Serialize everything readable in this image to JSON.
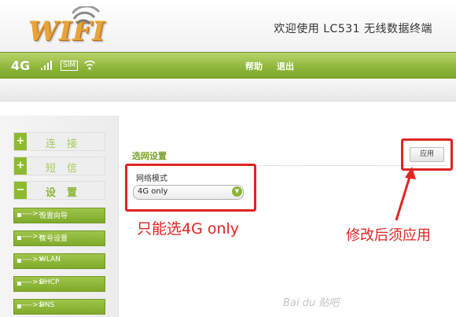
{
  "header": {
    "logo_text": "WIFI",
    "welcome": "欢迎使用 LC531 无线数据终端"
  },
  "navbar": {
    "network": "4G",
    "sim_label": "SIM",
    "help": "帮助",
    "logout": "退出",
    "icons": [
      "signal-icon",
      "sim-icon",
      "wifi-icon"
    ]
  },
  "sidebar": {
    "menus": [
      {
        "label": "连接",
        "symbol": "+"
      },
      {
        "label": "短信",
        "symbol": "+"
      },
      {
        "label": "设置",
        "symbol": "−"
      }
    ],
    "sub_arrow": "---->>",
    "sub_items": [
      "设置向导",
      "拨号设置",
      "WLAN",
      "DHCP",
      "DNS"
    ]
  },
  "main": {
    "section_title": "选网设置",
    "apply": "应用",
    "mode_label": "网络模式",
    "mode_value": "4G only",
    "select_arrow": "▼"
  },
  "annotations": {
    "note_select": "只能选4G only",
    "note_apply": "修改后须应用",
    "color": "#e02424"
  },
  "watermark": "Bai du 贴吧",
  "colors": {
    "accent_green": "#8db534",
    "nav_green": "#8cb43a"
  }
}
